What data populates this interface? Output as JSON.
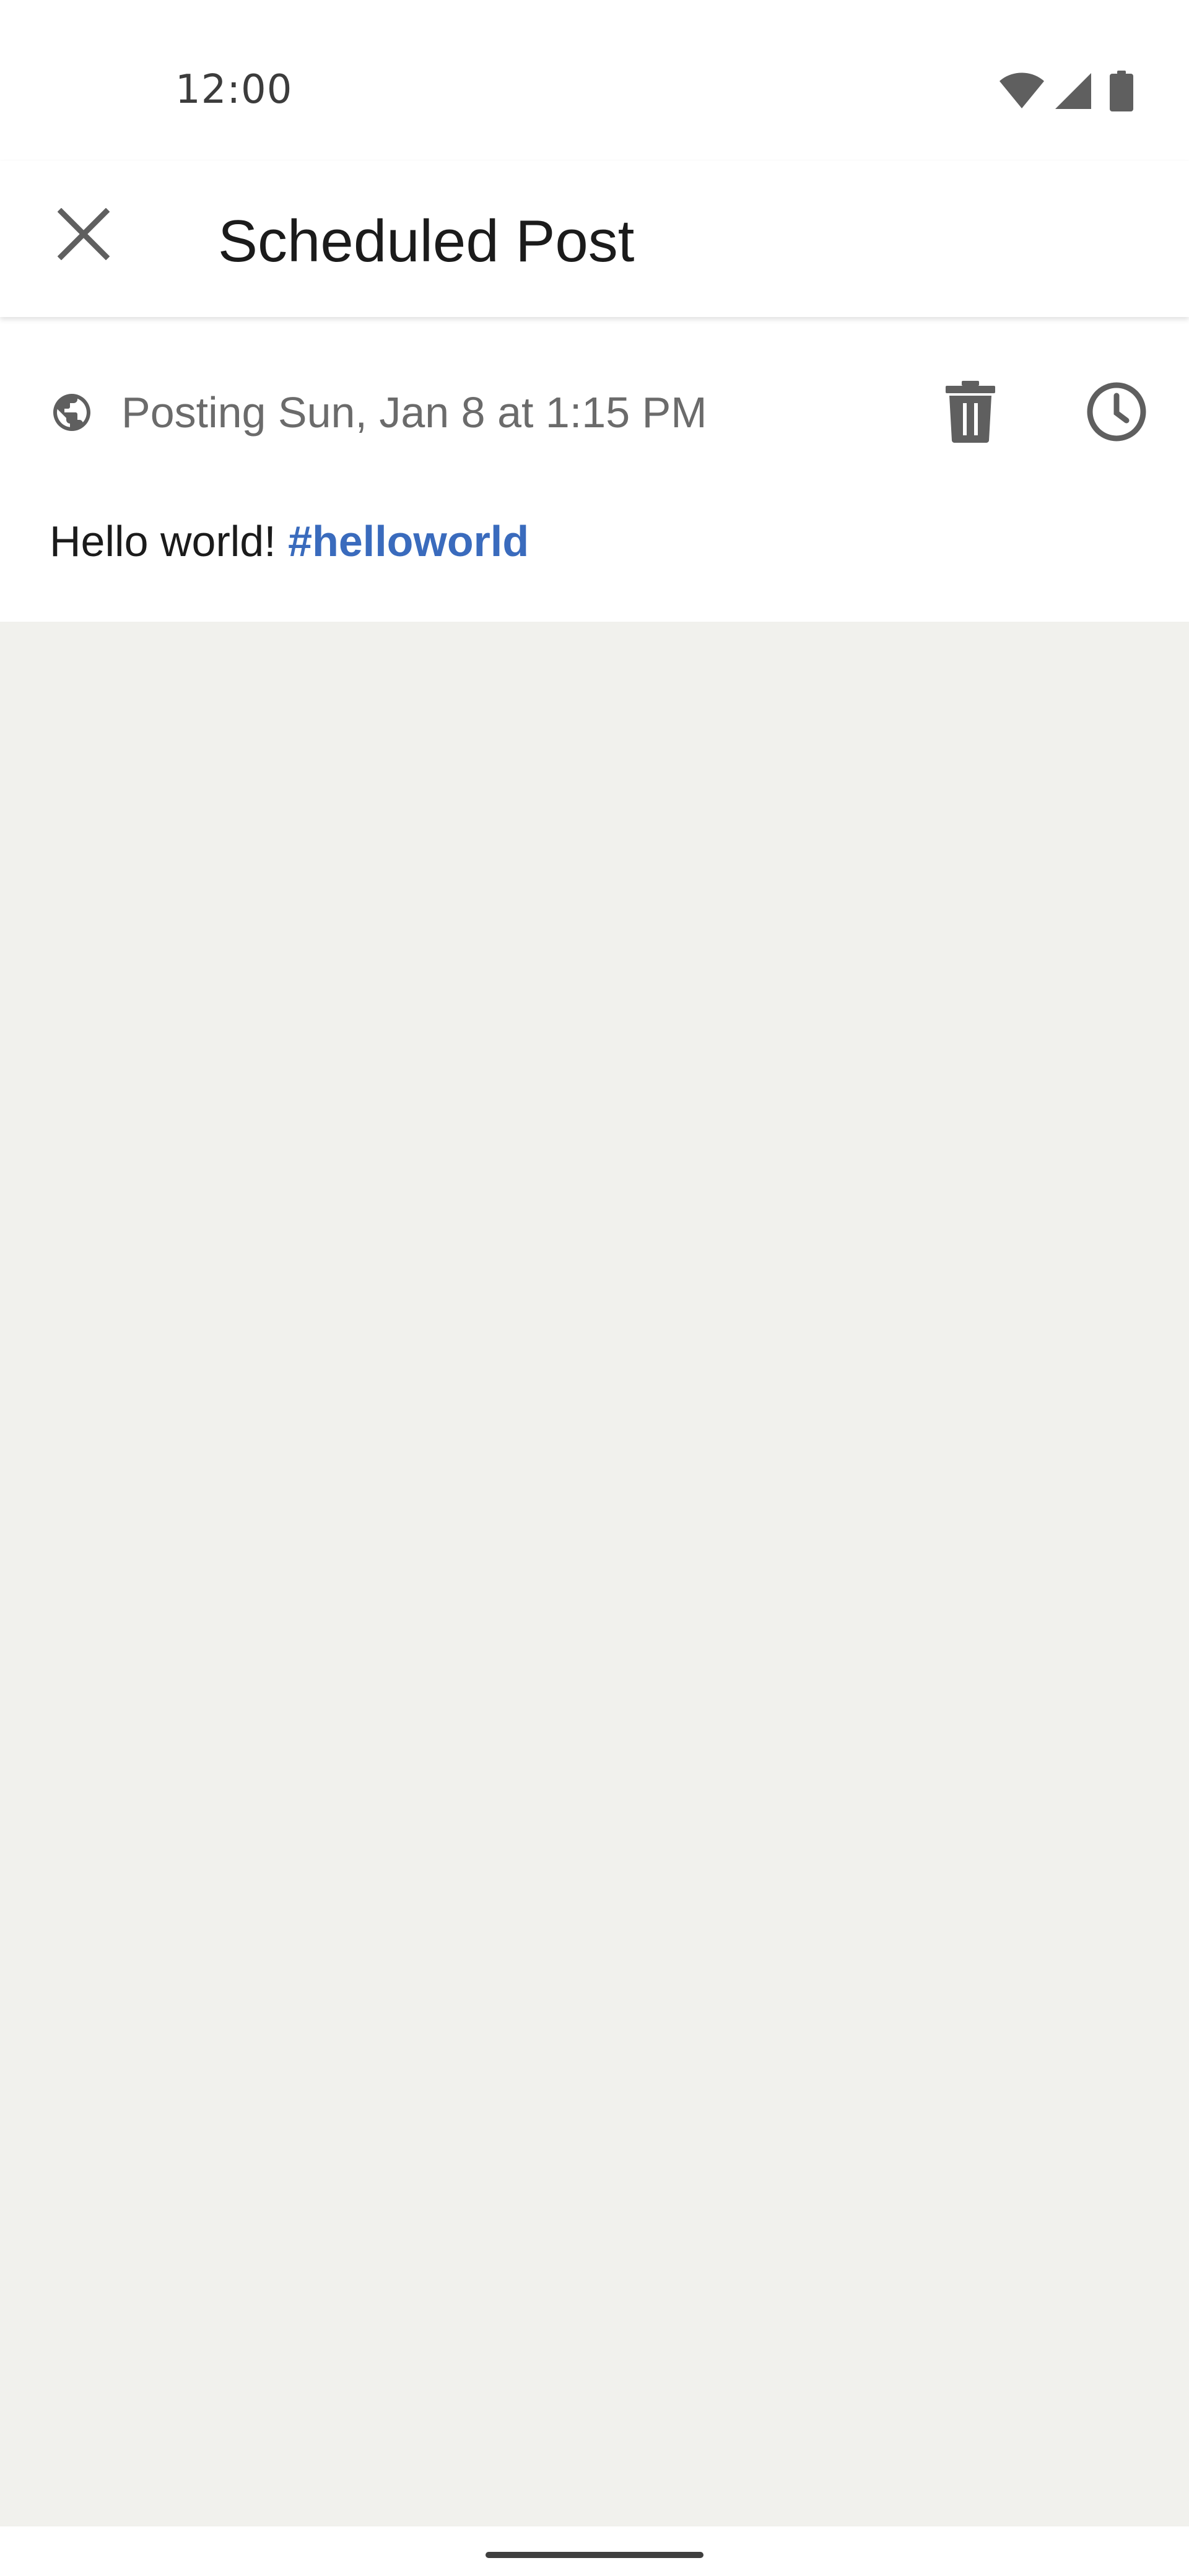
{
  "status_bar": {
    "time": "12:00",
    "icons": [
      "wifi-icon",
      "cell-signal-icon",
      "battery-icon"
    ]
  },
  "app_bar": {
    "close_icon": "close-icon",
    "title": "Scheduled Post"
  },
  "post": {
    "visibility_icon": "globe-icon",
    "schedule_text": "Posting Sun, Jan 8 at 1:15 PM",
    "delete_icon": "trash-icon",
    "reschedule_icon": "clock-icon",
    "body_text": "Hello world!",
    "hashtag": "#helloworld"
  },
  "colors": {
    "surface": "#ffffff",
    "background": "#f1f1ed",
    "text_primary": "#1b1b1b",
    "text_secondary": "#6b6b6b",
    "icon": "#5f5f5f",
    "hashtag": "#3a6bbd"
  }
}
